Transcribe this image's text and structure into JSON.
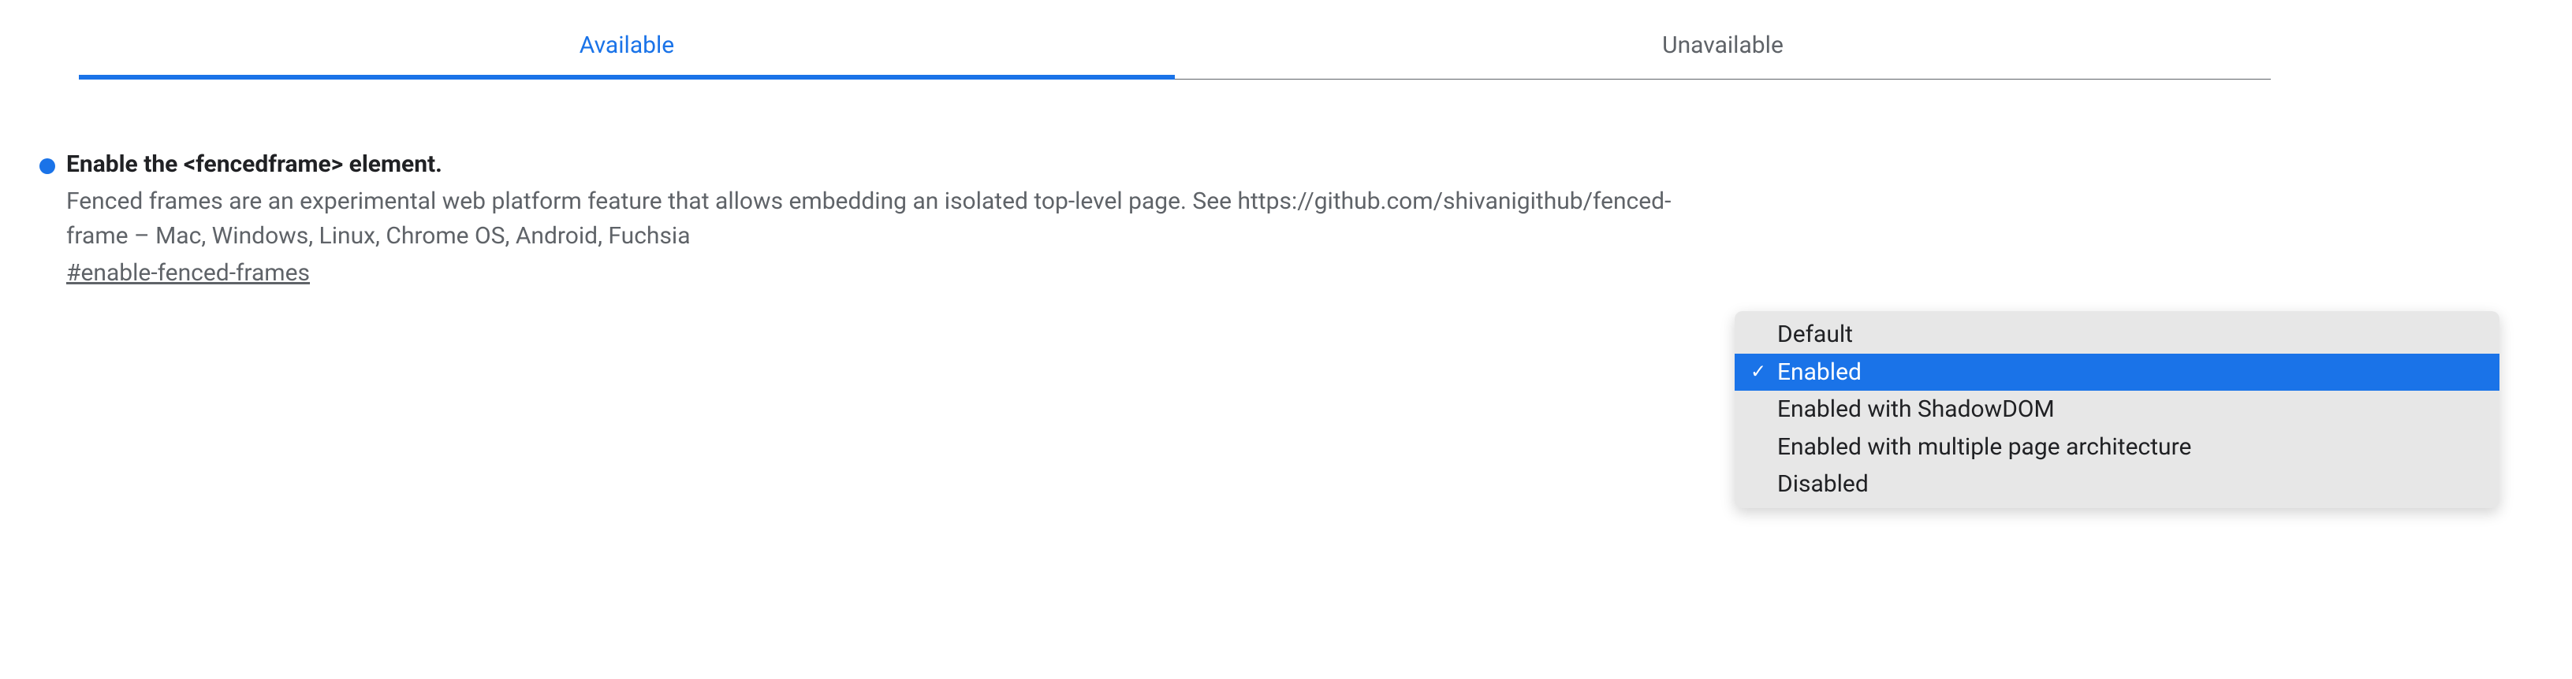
{
  "tabs": {
    "available": "Available",
    "unavailable": "Unavailable"
  },
  "flag": {
    "title": "Enable the <fencedframe> element.",
    "description": "Fenced frames are an experimental web platform feature that allows embedding an isolated top-level page. See https://github.com/shivanigithub/fenced-frame – Mac, Windows, Linux, Chrome OS, Android, Fuchsia",
    "anchor": "#enable-fenced-frames"
  },
  "dropdown": {
    "options": [
      "Default",
      "Enabled",
      "Enabled with ShadowDOM",
      "Enabled with multiple page architecture",
      "Disabled"
    ],
    "selected_index": 1
  }
}
